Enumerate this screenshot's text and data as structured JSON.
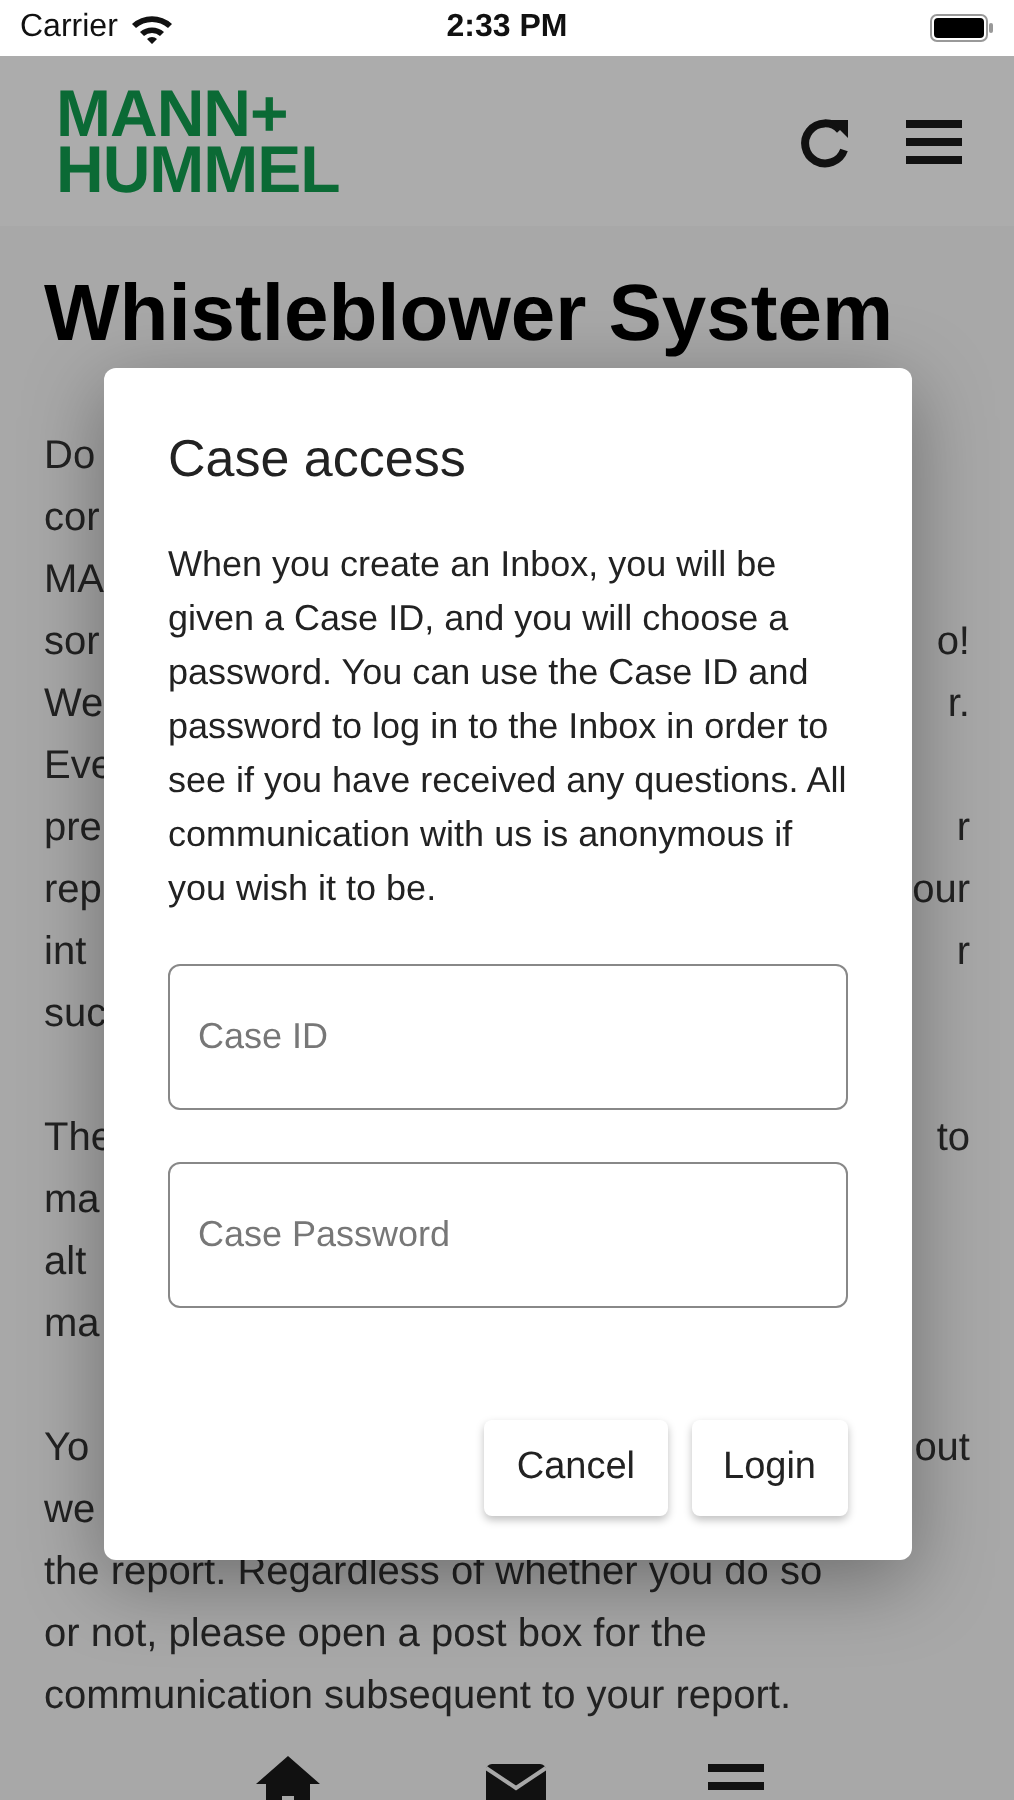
{
  "status_bar": {
    "carrier": "Carrier",
    "time": "2:33 PM"
  },
  "header": {
    "logo_lines": [
      "MANN+",
      "HUMMEL"
    ]
  },
  "page": {
    "title": "Whistleblower System",
    "paragraphs": [
      [
        {
          "left": "Do"
        },
        {
          "left": "cor"
        },
        {
          "left": "MA"
        },
        {
          "left": "sor",
          "right": "o!"
        },
        {
          "left": "We",
          "right": "r."
        },
        {
          "left": "Eve"
        },
        {
          "left": "pre",
          "right": "r"
        },
        {
          "left": "rep",
          "right": "our"
        },
        {
          "left": "int",
          "right": "r"
        },
        {
          "left": "suc"
        }
      ],
      [
        {
          "left": "The",
          "right": "to"
        },
        {
          "left": "ma"
        },
        {
          "left": "alt"
        },
        {
          "left": "ma"
        }
      ],
      [
        {
          "left": "Yo",
          "right": "out"
        },
        {
          "left": "we"
        },
        {
          "left": "the report. Regardless of whether you do so"
        },
        {
          "left": "or not, please open a post box for the"
        },
        {
          "left": "communication subsequent to your report."
        }
      ]
    ]
  },
  "dialog": {
    "title": "Case access",
    "text": "When you create an Inbox, you will be given a Case ID, and you will choose a password. You can use the Case ID and password to log in to the Inbox in order to see if you have received any questions. All communication with us is anonymous if you wish it to be.",
    "fields": [
      {
        "placeholder": "Case ID"
      },
      {
        "placeholder": "Case Password"
      }
    ],
    "buttons": [
      "Cancel",
      "Login"
    ]
  }
}
